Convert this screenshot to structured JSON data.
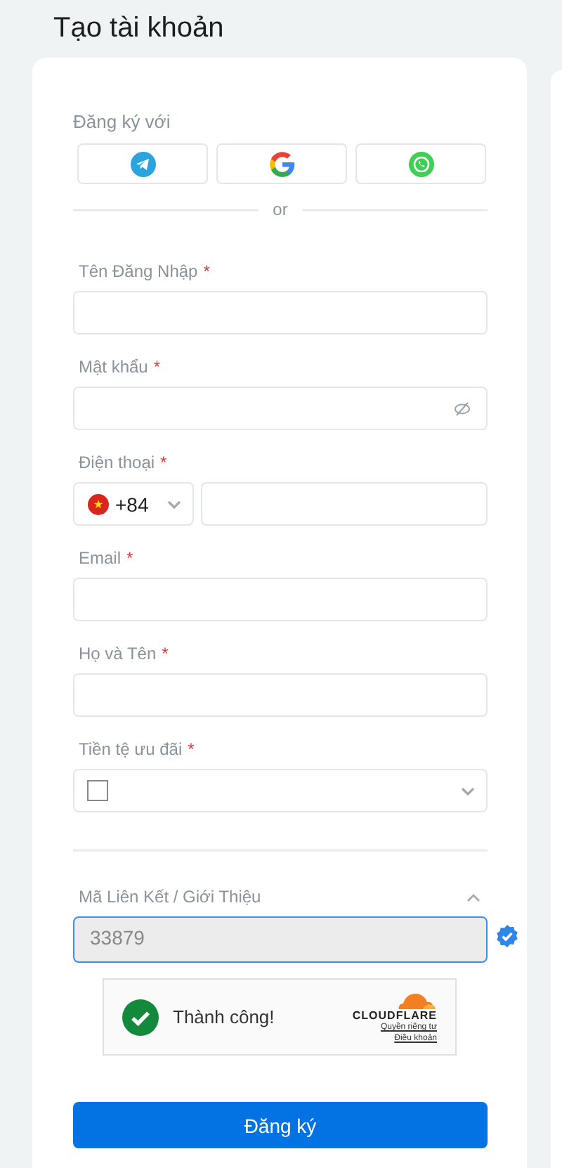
{
  "page_title": "Tạo tài khoản",
  "social": {
    "label": "Đăng ký với",
    "providers": [
      {
        "kind": "telegram"
      },
      {
        "kind": "google"
      },
      {
        "kind": "whatsapp"
      }
    ]
  },
  "divider_text": "or",
  "required_mark": "*",
  "fields": [
    {
      "kind": "text",
      "label": "Tên Đăng Nhập",
      "required": true
    },
    {
      "kind": "password",
      "label": "Mật khẩu",
      "required": true
    },
    {
      "kind": "phone",
      "label": "Điện thoại",
      "required": true,
      "dial_code": "+84"
    },
    {
      "kind": "text",
      "label": "Email",
      "required": true
    },
    {
      "kind": "text",
      "label": "Họ và Tên",
      "required": true
    },
    {
      "kind": "select",
      "label": "Tiền tệ ưu đãi",
      "required": true
    }
  ],
  "referral": {
    "label": "Mã Liên Kết / Giới Thiệu",
    "expanded": true,
    "value": "33879",
    "verified": true
  },
  "captcha": {
    "status": "Thành công!",
    "brand": "CLOUDFLARE",
    "links": [
      "Quyền riêng tư",
      "Điều khoản"
    ]
  },
  "submit": "Đăng ký"
}
